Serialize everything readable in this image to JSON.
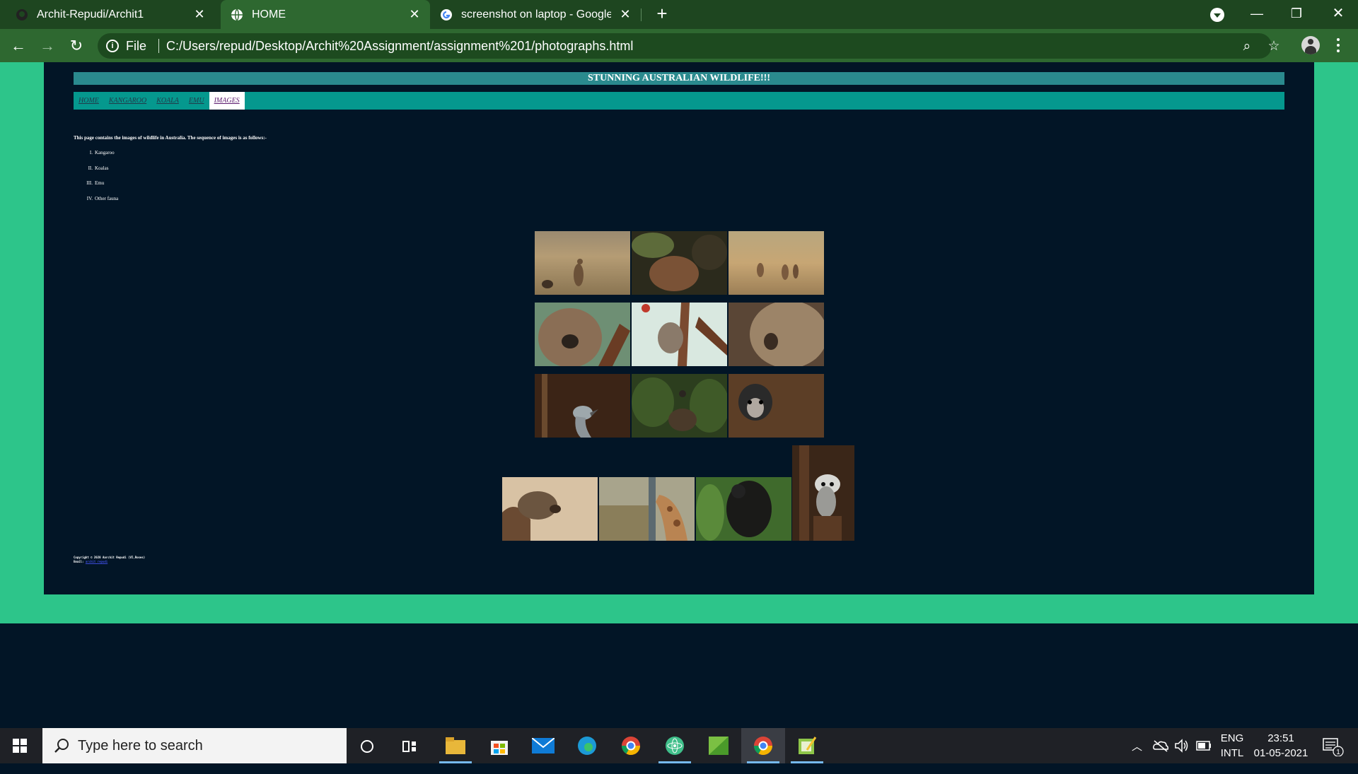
{
  "browser": {
    "tabs": [
      {
        "title": "Archit-Repudi/Archit1",
        "active": false,
        "icon": "github-icon"
      },
      {
        "title": "HOME",
        "active": true,
        "icon": "globe-icon"
      },
      {
        "title": "screenshot on laptop - Google Se",
        "active": false,
        "icon": "google-icon"
      }
    ],
    "new_tab_icon": "+",
    "scheme_label": "File",
    "url": "C:/Users/repud/Desktop/Archit%20Assignment/assignment%201/photographs.html"
  },
  "page": {
    "banner": "STUNNING AUSTRALIAN WILDLIFE!!!",
    "nav": [
      {
        "label": "HOME",
        "active": false
      },
      {
        "label": "KANGAROO",
        "active": false
      },
      {
        "label": "KOALA",
        "active": false
      },
      {
        "label": "EMU",
        "active": false
      },
      {
        "label": "IMAGES",
        "active": true
      }
    ],
    "intro": "This page contains the images of wildlife in Australia. The sequence of images is as follows:-",
    "list": [
      {
        "num": "I.",
        "text": "Kangaroo"
      },
      {
        "num": "II.",
        "text": "Koalas"
      },
      {
        "num": "III.",
        "text": "Emu"
      },
      {
        "num": "IV.",
        "text": "Other fauna"
      }
    ],
    "images": [
      {
        "alt": "kangaroo standing in grass field"
      },
      {
        "alt": "kangaroo eating leaves"
      },
      {
        "alt": "kangaroos group in field"
      },
      {
        "alt": "koala sleeping on branch"
      },
      {
        "alt": "koala on tree"
      },
      {
        "alt": "koala close-up"
      },
      {
        "alt": "emu profile"
      },
      {
        "alt": "emu in bushes"
      },
      {
        "alt": "emu face close-up"
      },
      {
        "alt": "echidna"
      },
      {
        "alt": "giraffe eating hay"
      },
      {
        "alt": "black monkey"
      },
      {
        "alt": "lemur"
      }
    ],
    "footer": {
      "copyright": "Copyright © 2020 Aarchit Repudi (VI,Roses)",
      "email_label": "Email:",
      "email_link": "archit repudi"
    }
  },
  "taskbar": {
    "search_placeholder": "Type here to search",
    "lang_top": "ENG",
    "lang_bottom": "INTL",
    "time": "23:51",
    "date": "01-05-2021",
    "notification_count": "1"
  }
}
